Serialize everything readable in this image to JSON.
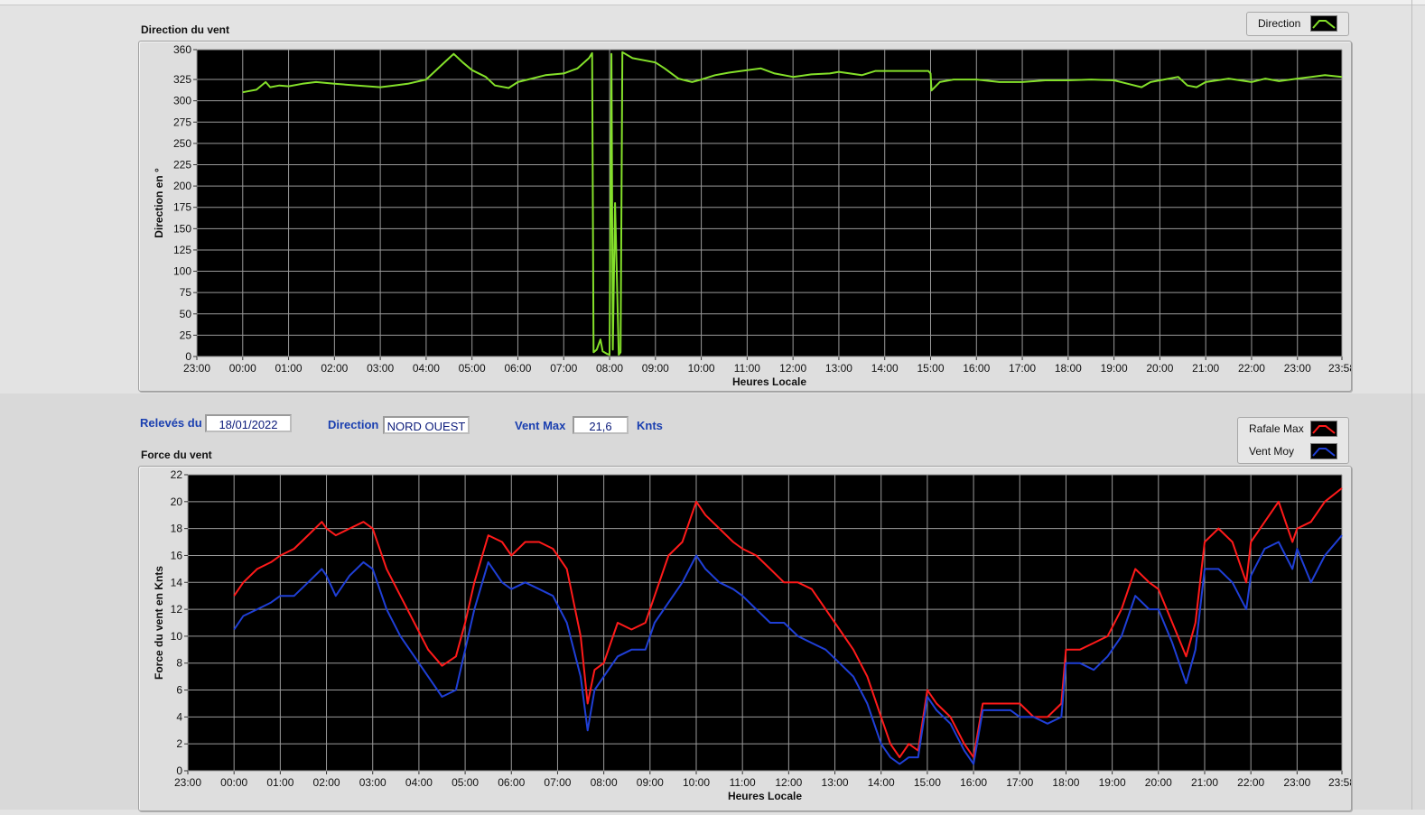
{
  "header": {
    "readings_label": "Relevés du",
    "date": "18/01/2022",
    "direction_label": "Direction",
    "direction_value": "NORD OUEST",
    "vmax_label": "Vent Max",
    "vmax_value": "21,6",
    "vmax_unit": "Knts"
  },
  "colors": {
    "direction": "#84e02a",
    "gust": "#ff1a1a",
    "mean": "#1f3fd6",
    "plot_bg": "#000000",
    "grid": "#9a9a9a",
    "label": "#1a3fb0"
  },
  "chart_data": [
    {
      "type": "line",
      "title": "Direction du vent",
      "xlabel": "Heures Locale",
      "ylabel": "Direction en °",
      "xlim": [
        -1.0,
        23.97
      ],
      "ylim": [
        0,
        360
      ],
      "xticks": [
        "23:00",
        "00:00",
        "01:00",
        "02:00",
        "03:00",
        "04:00",
        "05:00",
        "06:00",
        "07:00",
        "08:00",
        "09:00",
        "10:00",
        "11:00",
        "12:00",
        "13:00",
        "14:00",
        "15:00",
        "16:00",
        "17:00",
        "18:00",
        "19:00",
        "20:00",
        "21:00",
        "22:00",
        "23:00",
        "23:58"
      ],
      "xtick_values": [
        -1,
        0,
        1,
        2,
        3,
        4,
        5,
        6,
        7,
        8,
        9,
        10,
        11,
        12,
        13,
        14,
        15,
        16,
        17,
        18,
        19,
        20,
        21,
        22,
        23,
        23.97
      ],
      "yticks": [
        0,
        25,
        50,
        75,
        100,
        125,
        150,
        175,
        200,
        225,
        250,
        275,
        300,
        325,
        360
      ],
      "legend": "top-right",
      "series": [
        {
          "name": "Direction",
          "x": [
            0.0,
            0.3,
            0.5,
            0.6,
            0.8,
            1.0,
            1.3,
            1.6,
            2.0,
            2.5,
            3.0,
            3.3,
            3.6,
            4.0,
            4.3,
            4.5,
            4.6,
            4.8,
            5.0,
            5.3,
            5.5,
            5.8,
            6.0,
            6.3,
            6.6,
            7.0,
            7.3,
            7.55,
            7.62,
            7.65,
            7.72,
            7.8,
            7.85,
            7.95,
            8.0,
            8.04,
            8.07,
            8.12,
            8.2,
            8.24,
            8.28,
            8.5,
            9.0,
            9.2,
            9.5,
            9.8,
            10.0,
            10.3,
            10.6,
            11.0,
            11.3,
            11.6,
            12.0,
            12.4,
            12.8,
            13.0,
            13.5,
            13.8,
            14.0,
            14.5,
            14.95,
            15.0,
            15.02,
            15.2,
            15.5,
            16.0,
            16.5,
            17.0,
            17.5,
            18.0,
            18.5,
            19.0,
            19.3,
            19.6,
            19.8,
            20.0,
            20.2,
            20.4,
            20.6,
            20.8,
            21.0,
            21.5,
            22.0,
            22.3,
            22.6,
            23.0,
            23.3,
            23.6,
            23.97
          ],
          "values": [
            310,
            313,
            322,
            316,
            318,
            317,
            320,
            322,
            320,
            318,
            316,
            318,
            320,
            325,
            340,
            350,
            355,
            345,
            336,
            328,
            318,
            315,
            322,
            326,
            330,
            332,
            338,
            350,
            356,
            5,
            8,
            20,
            6,
            3,
            2,
            355,
            8,
            180,
            2,
            5,
            357,
            350,
            345,
            338,
            326,
            322,
            325,
            330,
            333,
            336,
            338,
            332,
            328,
            331,
            332,
            334,
            330,
            335,
            335,
            335,
            335,
            332,
            312,
            322,
            325,
            325,
            322,
            322,
            324,
            324,
            325,
            324,
            320,
            316,
            322,
            324,
            326,
            328,
            318,
            316,
            322,
            326,
            322,
            326,
            323,
            326,
            328,
            330,
            328
          ]
        }
      ]
    },
    {
      "type": "line",
      "title": "Force du vent",
      "xlabel": "Heures Locale",
      "ylabel": "Force du vent en Knts",
      "xlim": [
        -1.0,
        23.97
      ],
      "ylim": [
        0,
        22
      ],
      "xticks": [
        "23:00",
        "00:00",
        "01:00",
        "02:00",
        "03:00",
        "04:00",
        "05:00",
        "06:00",
        "07:00",
        "08:00",
        "09:00",
        "10:00",
        "11:00",
        "12:00",
        "13:00",
        "14:00",
        "15:00",
        "16:00",
        "17:00",
        "18:00",
        "19:00",
        "20:00",
        "21:00",
        "22:00",
        "23:00",
        "23:58"
      ],
      "xtick_values": [
        -1,
        0,
        1,
        2,
        3,
        4,
        5,
        6,
        7,
        8,
        9,
        10,
        11,
        12,
        13,
        14,
        15,
        16,
        17,
        18,
        19,
        20,
        21,
        22,
        23,
        23.97
      ],
      "yticks": [
        0,
        2,
        4,
        6,
        8,
        10,
        12,
        14,
        16,
        18,
        20,
        22
      ],
      "legend": "top-right",
      "series": [
        {
          "name": "Rafale Max",
          "x": [
            0.0,
            0.2,
            0.5,
            0.8,
            1.0,
            1.3,
            1.6,
            1.9,
            2.0,
            2.2,
            2.5,
            2.8,
            3.0,
            3.3,
            3.6,
            3.9,
            4.2,
            4.5,
            4.8,
            5.0,
            5.2,
            5.5,
            5.8,
            6.0,
            6.3,
            6.6,
            6.9,
            7.2,
            7.5,
            7.65,
            7.8,
            8.0,
            8.3,
            8.6,
            8.9,
            9.1,
            9.4,
            9.7,
            10.0,
            10.2,
            10.5,
            10.8,
            11.0,
            11.3,
            11.6,
            11.9,
            12.2,
            12.5,
            12.8,
            13.1,
            13.4,
            13.7,
            14.0,
            14.2,
            14.4,
            14.6,
            14.8,
            15.0,
            15.2,
            15.5,
            15.8,
            16.0,
            16.2,
            16.5,
            16.8,
            17.0,
            17.3,
            17.6,
            17.9,
            18.0,
            18.3,
            18.6,
            18.9,
            19.2,
            19.5,
            19.8,
            20.0,
            20.3,
            20.6,
            20.8,
            21.0,
            21.3,
            21.6,
            21.9,
            22.0,
            22.3,
            22.6,
            22.9,
            23.0,
            23.3,
            23.6,
            23.97
          ],
          "values": [
            13,
            14,
            15,
            15.5,
            16,
            16.5,
            17.5,
            18.5,
            18,
            17.5,
            18,
            18.5,
            18,
            15,
            13,
            11,
            9,
            7.8,
            8.5,
            11,
            14,
            17.5,
            17,
            16,
            17,
            17,
            16.5,
            15,
            10,
            5,
            7.5,
            8,
            11,
            10.5,
            11,
            13,
            16,
            17,
            20,
            19,
            18,
            17,
            16.5,
            16,
            15,
            14,
            14,
            13.5,
            12,
            10.5,
            9,
            7,
            4,
            2,
            1,
            2,
            1.5,
            6,
            5,
            4,
            2,
            1,
            5,
            5,
            5,
            5,
            4,
            4,
            5,
            9,
            9,
            9.5,
            10,
            12,
            15,
            14,
            13.5,
            11,
            8.5,
            11,
            17,
            18,
            17,
            14,
            17,
            18.5,
            20,
            17,
            18,
            18.5,
            20,
            21
          ]
        },
        {
          "name": "Vent Moy",
          "x": [
            0.0,
            0.2,
            0.5,
            0.8,
            1.0,
            1.3,
            1.6,
            1.9,
            2.0,
            2.2,
            2.5,
            2.8,
            3.0,
            3.3,
            3.6,
            3.9,
            4.2,
            4.5,
            4.8,
            5.0,
            5.2,
            5.5,
            5.8,
            6.0,
            6.3,
            6.6,
            6.9,
            7.2,
            7.5,
            7.65,
            7.8,
            8.0,
            8.3,
            8.6,
            8.9,
            9.1,
            9.4,
            9.7,
            10.0,
            10.2,
            10.5,
            10.8,
            11.0,
            11.3,
            11.6,
            11.9,
            12.2,
            12.5,
            12.8,
            13.1,
            13.4,
            13.7,
            14.0,
            14.2,
            14.4,
            14.6,
            14.8,
            15.0,
            15.2,
            15.5,
            15.8,
            16.0,
            16.2,
            16.5,
            16.8,
            17.0,
            17.3,
            17.6,
            17.9,
            18.0,
            18.3,
            18.6,
            18.9,
            19.2,
            19.5,
            19.8,
            20.0,
            20.3,
            20.6,
            20.8,
            21.0,
            21.3,
            21.6,
            21.9,
            22.0,
            22.3,
            22.6,
            22.9,
            23.0,
            23.3,
            23.6,
            23.97
          ],
          "values": [
            10.5,
            11.5,
            12,
            12.5,
            13,
            13,
            14,
            15,
            14.5,
            13,
            14.5,
            15.5,
            15,
            12,
            10,
            8.5,
            7,
            5.5,
            6,
            9,
            12,
            15.5,
            14,
            13.5,
            14,
            13.5,
            13,
            11,
            7,
            3,
            6,
            7,
            8.5,
            9,
            9,
            11,
            12.5,
            14,
            16,
            15,
            14,
            13.5,
            13,
            12,
            11,
            11,
            10,
            9.5,
            9,
            8,
            7,
            5,
            2,
            1,
            0.5,
            1,
            1,
            5.5,
            4.5,
            3.5,
            1.5,
            0.5,
            4.5,
            4.5,
            4.5,
            4,
            4,
            3.5,
            4,
            8,
            8,
            7.5,
            8.5,
            10,
            13,
            12,
            12,
            9.5,
            6.5,
            9,
            15,
            15,
            14,
            12,
            14.5,
            16.5,
            17,
            15,
            16.5,
            14,
            16,
            17.5
          ]
        }
      ]
    }
  ]
}
